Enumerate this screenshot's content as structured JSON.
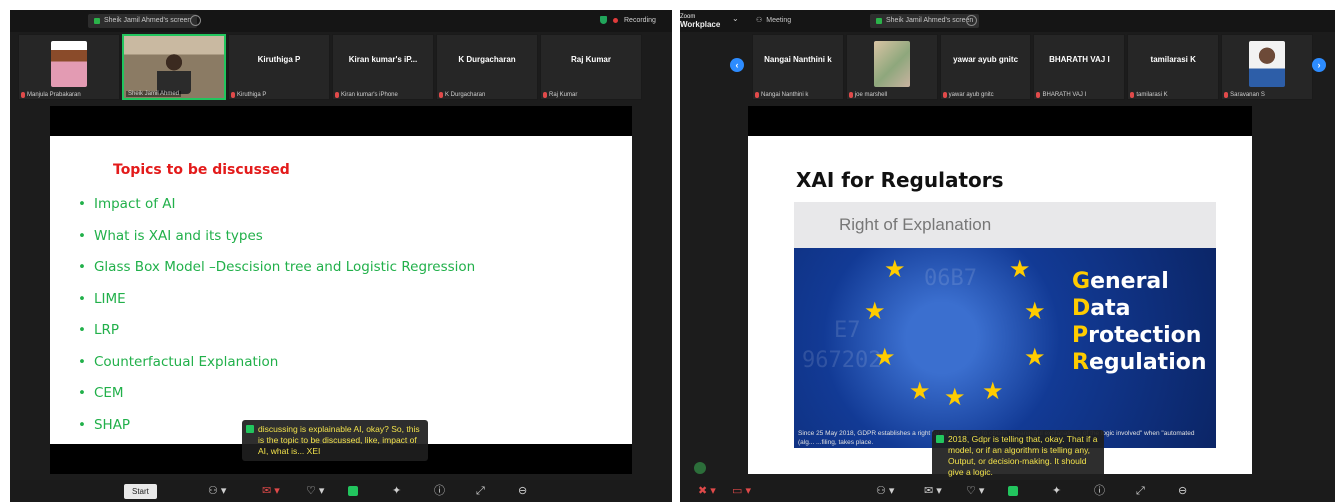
{
  "left": {
    "share_label": "Sheik Jamil Ahmed's screen",
    "recording": "Recording",
    "participants": [
      {
        "name": "",
        "caption": "Manjula Prabakaran",
        "photo": "woman"
      },
      {
        "name": "",
        "caption": "Sheik Jamil Ahmed",
        "photo": "camera"
      },
      {
        "name": "Kiruthiga P",
        "caption": "Kiruthiga P"
      },
      {
        "name": "Kiran kumar's iP...",
        "caption": "Kiran kumar's iPhone"
      },
      {
        "name": "K Durgacharan",
        "caption": "K Durgacharan"
      },
      {
        "name": "Raj Kumar",
        "caption": "Raj Kumar"
      }
    ],
    "slide": {
      "title": "Topics to be discussed",
      "bullets": [
        "Impact of AI",
        "What is XAI and its types",
        "Glass Box Model –Descision tree and Logistic Regression",
        "LIME",
        "LRP",
        "Counterfactual Explanation",
        "CEM",
        "SHAP"
      ]
    },
    "subtitle": "discussing is explainable AI, okay? So, this is the topic to be discussed, like, impact of AI, what is... XEI",
    "start_button": "Start"
  },
  "right": {
    "app_name": "Workplace",
    "app_small": "Zoom",
    "meeting_label": "Meeting",
    "share_label": "Sheik Jamil Ahmed's screen",
    "participants": [
      {
        "name": "Nangai Nanthini k",
        "caption": "Nangai Nanthini k"
      },
      {
        "name": "",
        "caption": "joe marshell",
        "photo": "group"
      },
      {
        "name": "yawar ayub gnitc",
        "caption": "yawar ayub gnitc"
      },
      {
        "name": "BHARATH VAJ I",
        "caption": "BHARATH VAJ I"
      },
      {
        "name": "tamilarasi K",
        "caption": "tamilarasi K"
      },
      {
        "name": "",
        "caption": "Saravanan S",
        "photo": "man"
      }
    ],
    "slide": {
      "title": "XAI for Regulators",
      "figure_heading": "Right of Explanation",
      "gdpr": [
        "General",
        "Data",
        "Protection",
        "Regulation"
      ],
      "caption": "Since 25 May 2018, GDPR establishes a right for all individuals to obtain \"meaningful explanations of the logic involved\" when \"automated (alg... ...filing, takes place."
    },
    "subtitle": "2018, Gdpr is telling that, okay. That if a model, or if an algorithm is telling any, Output, or decision-making. It should give a logic."
  },
  "icons": [
    "participants-icon",
    "chat-icon",
    "reactions-icon",
    "share-screen-icon",
    "apps-icon",
    "info-icon",
    "expand-icon",
    "leave-icon"
  ]
}
